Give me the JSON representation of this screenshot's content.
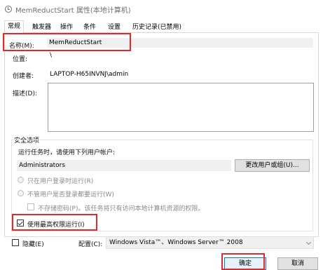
{
  "window": {
    "title": "MemReductStart 属性(本地计算机)"
  },
  "tabs": [
    "常规",
    "触发器",
    "操作",
    "条件",
    "设置",
    "历史记录(已禁用)"
  ],
  "general": {
    "name_label": "名称(M):",
    "name_value": "MemReductStart",
    "location_label": "位置:",
    "location_value": "\\",
    "author_label": "创建者:",
    "author_value": "LAPTOP-H65INVNJ\\admin",
    "description_label": "描述(D):",
    "description_value": ""
  },
  "security": {
    "group_label": "安全选项",
    "run_as_label": "运行任务时，请使用下列用户帐户:",
    "account_value": "Administrators",
    "change_user_button": "更改用户或组(U)...",
    "radio_logged_on": "只在用户登录时运行(R)",
    "radio_any": "不管用户是否登录都要运行(W)",
    "no_store_password": "不存储密码(P)。该任务将只有访问本地计算机资源的权限。",
    "highest_privileges": "使用最高权限运行(I)",
    "highest_privileges_checked": true
  },
  "bottom": {
    "hidden_label": "隐藏(E)",
    "hidden_checked": false,
    "configure_label": "配置(C):",
    "configure_value": "Windows Vista™、Windows Server™ 2008"
  },
  "buttons": {
    "ok": "确定",
    "cancel": "取消"
  },
  "highlight_color": "#e3282b"
}
